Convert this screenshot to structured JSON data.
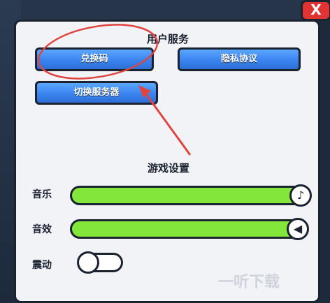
{
  "close_label": "X",
  "user_services": {
    "title": "用户服务",
    "redeem_code": "兑换码",
    "privacy_policy": "隐私协议",
    "switch_server": "切换服务器"
  },
  "game_settings": {
    "title": "游戏设置",
    "music_label": "音乐",
    "music_level": 1.0,
    "sfx_label": "音效",
    "sfx_level": 1.0,
    "vibration_label": "震动",
    "vibration_on": false
  },
  "watermark": "一听下载",
  "colors": {
    "accent_blue": "#3a84f0",
    "slider_green": "#83e63a",
    "annotation_red": "#e0443f"
  }
}
